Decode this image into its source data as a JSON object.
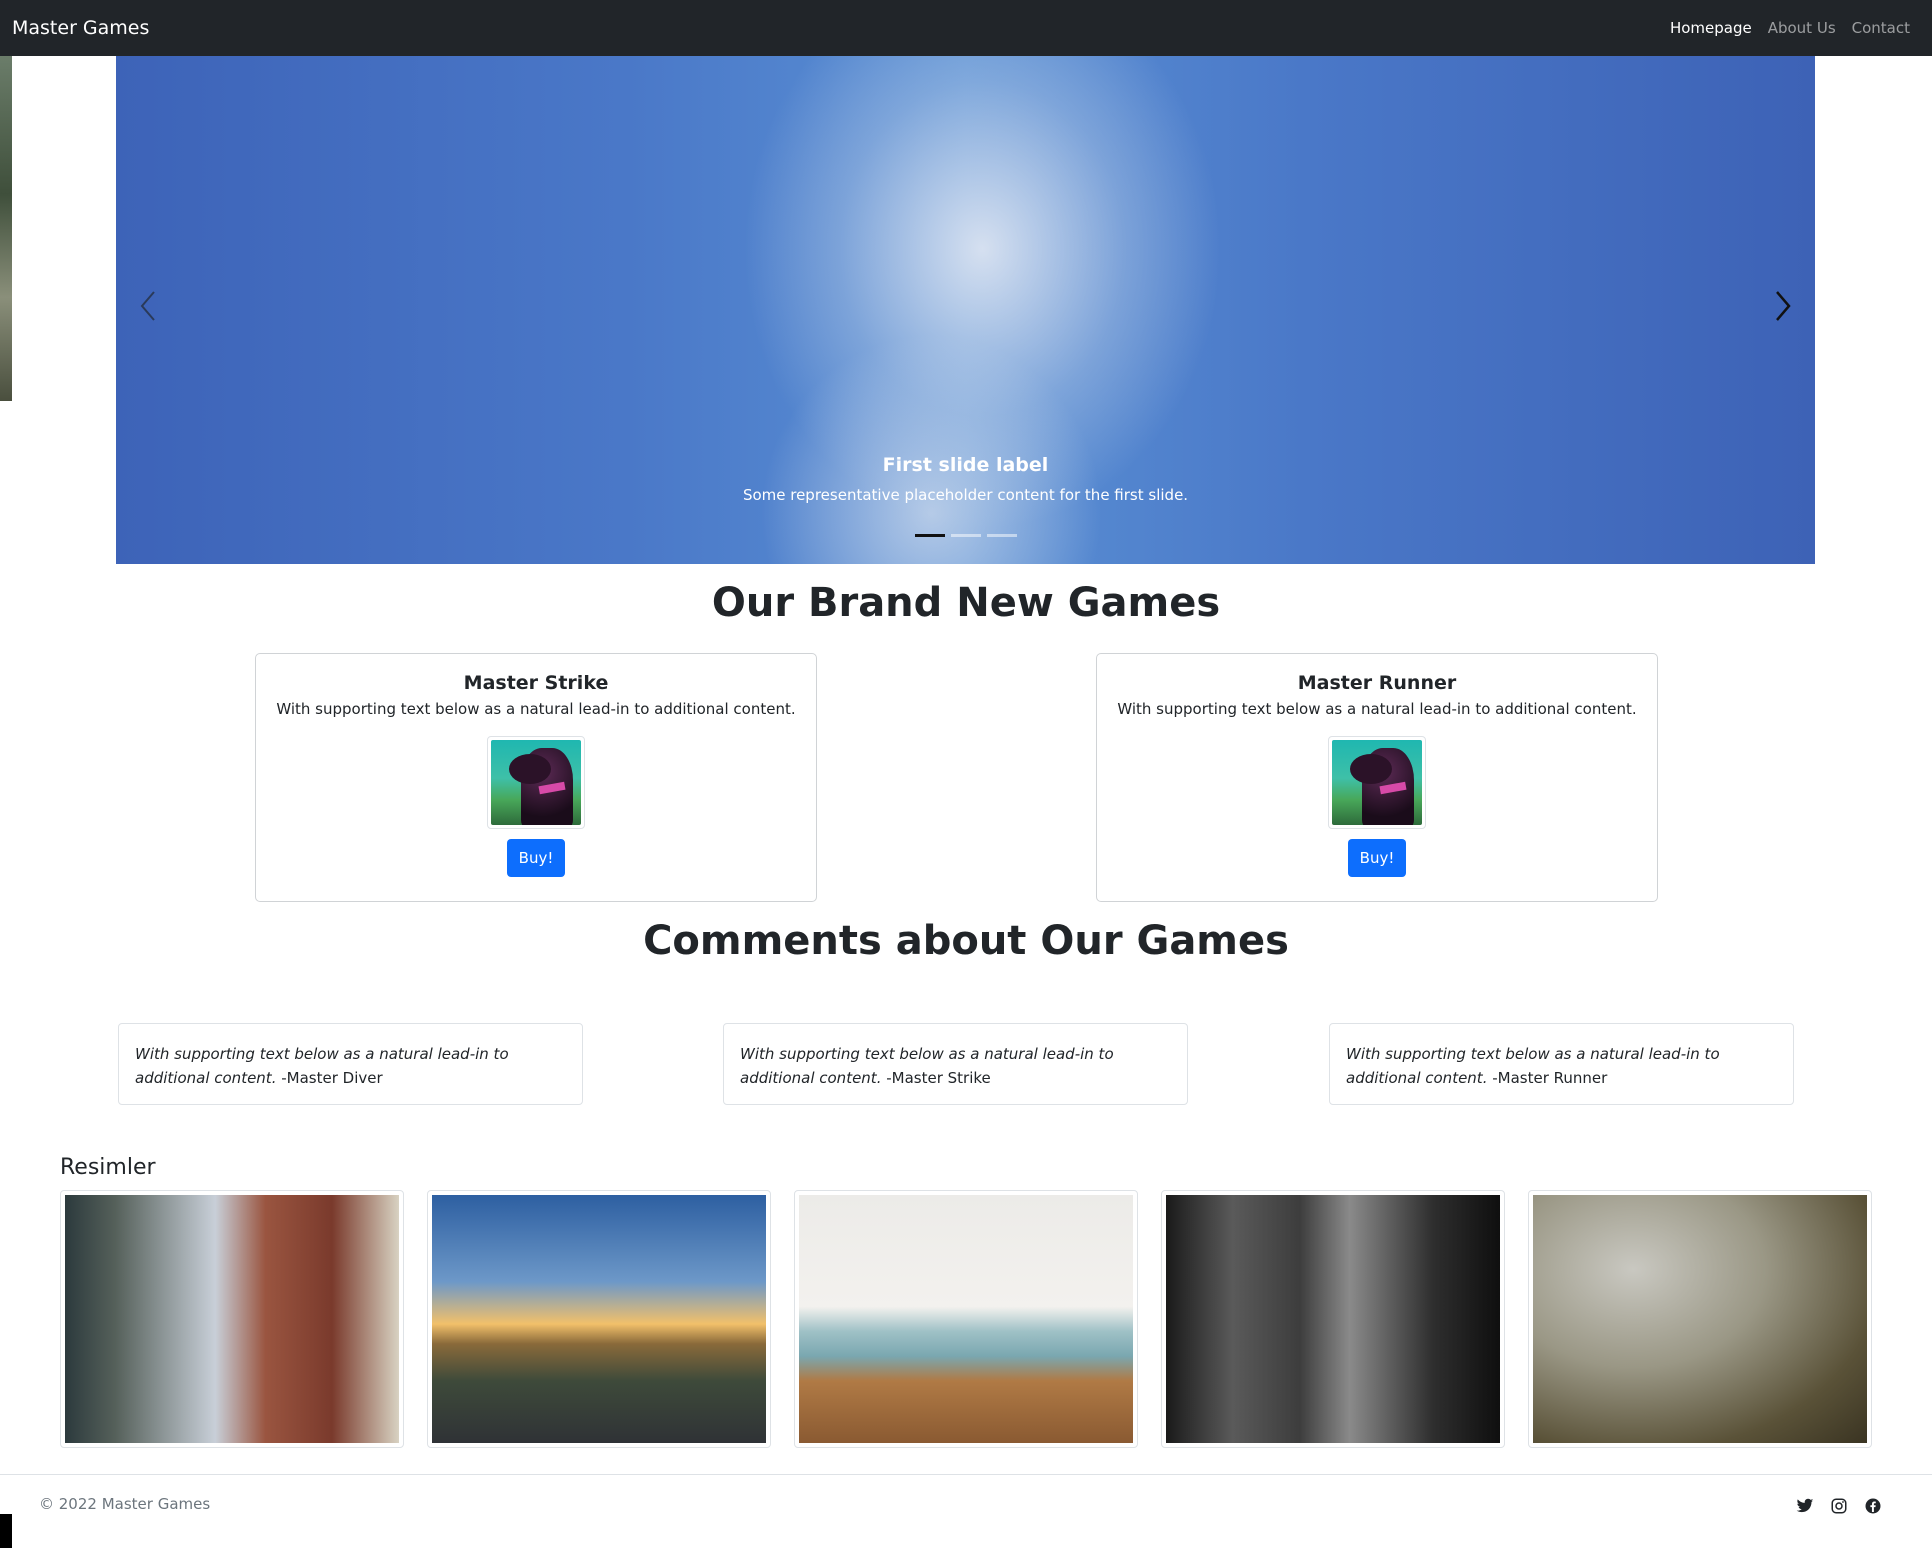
{
  "navbar": {
    "brand": "Master Games",
    "links": [
      "Homepage",
      "About Us",
      "Contact"
    ]
  },
  "carousel": {
    "caption_title": "First slide label",
    "caption_text": "Some representative placeholder content for the first slide."
  },
  "games": {
    "heading": "Our Brand New Games",
    "cards": [
      {
        "title": "Master Strike",
        "text": "With supporting text below as a natural lead-in to additional content.",
        "button": "Buy!"
      },
      {
        "title": "Master Runner",
        "text": "With supporting text below as a natural lead-in to additional content.",
        "button": "Buy!"
      }
    ]
  },
  "comments": {
    "heading": "Comments about Our Games",
    "items": [
      {
        "text": "With supporting text below as a natural lead-in to additional content.",
        "author": "-Master Diver"
      },
      {
        "text": "With supporting text below as a natural lead-in to additional content.",
        "author": "-Master Strike"
      },
      {
        "text": "With supporting text below as a natural lead-in to additional content.",
        "author": "-Master Runner"
      }
    ]
  },
  "gallery": {
    "title": "Resimler"
  },
  "footer": {
    "copyright": "© 2022 Master Games",
    "social_icons": [
      "twitter-icon",
      "instagram-icon",
      "facebook-icon"
    ]
  }
}
